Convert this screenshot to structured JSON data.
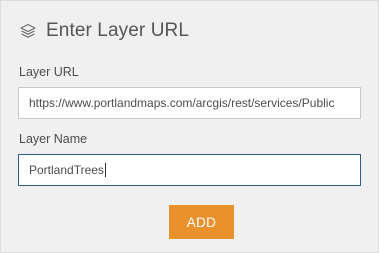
{
  "dialog": {
    "title": "Enter Layer URL",
    "title_icon": "layers-icon"
  },
  "layer_url": {
    "label": "Layer URL",
    "value": "https://www.portlandmaps.com/arcgis/rest/services/Public"
  },
  "layer_name": {
    "label": "Layer Name",
    "value": "PortlandTrees"
  },
  "actions": {
    "add_label": "ADD"
  },
  "colors": {
    "accent": "#e8912d",
    "focus_border": "#2f5d8c",
    "panel_bg": "#f0f0f0"
  }
}
